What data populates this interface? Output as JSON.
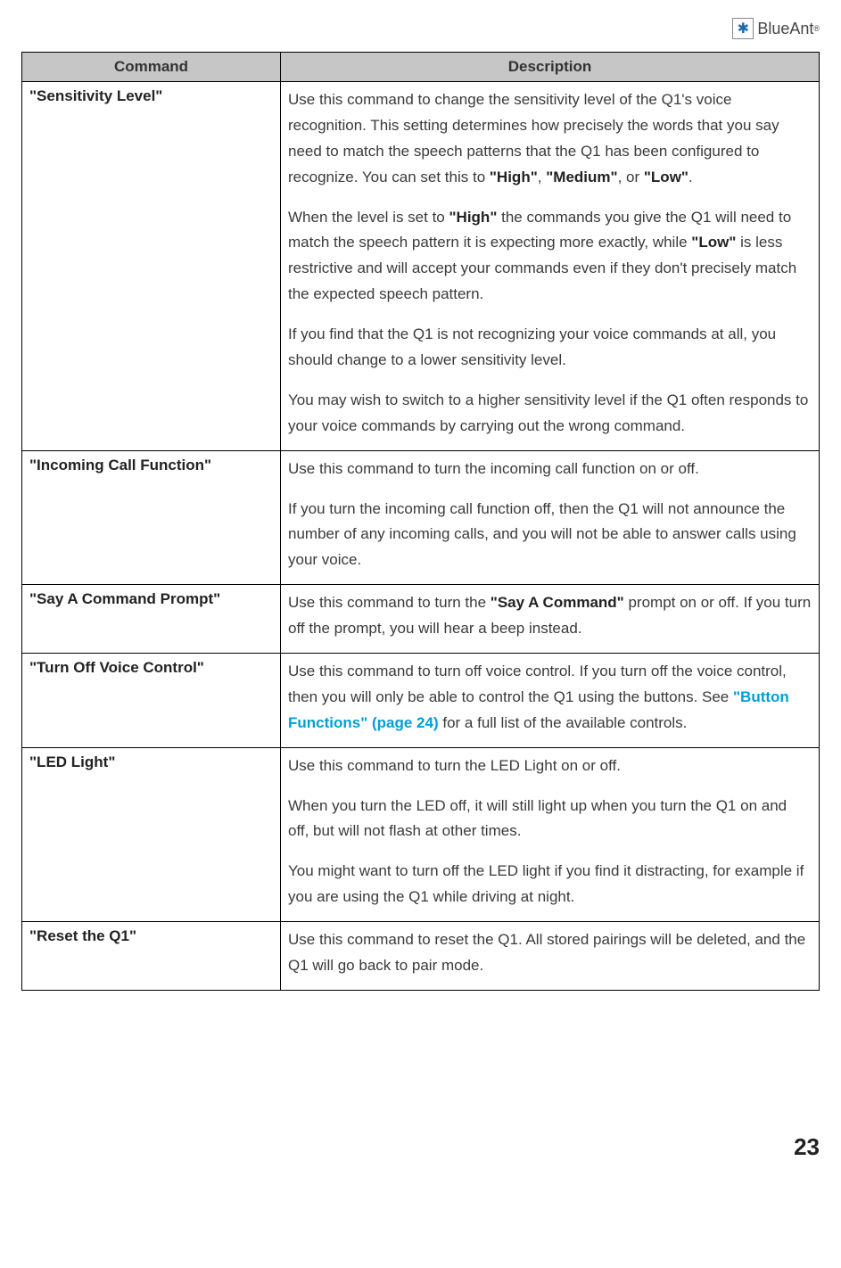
{
  "brand": "BlueAnt",
  "table": {
    "headers": {
      "command": "Command",
      "description": "Description"
    },
    "rows": [
      {
        "command": "\"Sensitivity Level\"",
        "desc": {
          "p1_a": "Use this command to change the sensitivity level of the Q1's voice recognition. This setting determines how precisely the words that you say need to match the speech patterns that the Q1 has been configured to recognize. You can set this to ",
          "p1_b1": "\"High\"",
          "p1_c": ", ",
          "p1_b2": "\"Medium\"",
          "p1_d": ", or ",
          "p1_b3": "\"Low\"",
          "p1_e": ".",
          "p2_a": "When the level is set to ",
          "p2_b1": "\"High\"",
          "p2_c": " the commands you give the Q1 will need to match the speech pattern it is expecting more exactly, while ",
          "p2_b2": "\"Low\"",
          "p2_d": " is less restrictive and will accept your commands even if they don't precisely match the expected speech pattern.",
          "p3": "If you find that the Q1 is not recognizing your voice commands at all, you should change to a lower sensitivity level.",
          "p4": "You may wish to switch to a higher sensitivity level if the Q1 often responds to your voice commands by carrying out the wrong command."
        }
      },
      {
        "command": "\"Incoming Call Function\"",
        "desc": {
          "p1": "Use this command to turn the incoming call function on or off.",
          "p2": "If you turn the incoming call function off, then the Q1 will not announce the number of any incoming calls, and you will not be able to answer calls using your voice."
        }
      },
      {
        "command": "\"Say A Command Prompt\"",
        "desc": {
          "p1_a": "Use this command to turn the ",
          "p1_b": "\"Say A Command\"",
          "p1_c": " prompt on or off. If you turn off the prompt, you will hear a beep instead."
        }
      },
      {
        "command": "\"Turn Off Voice Control\"",
        "desc": {
          "p1_a": "Use this command to turn off voice control. If you turn off the voice control, then you will only be able to control the Q1 using the buttons. See ",
          "p1_link": "\"Button Functions\" (page 24)",
          "p1_b": " for a full list of the available controls."
        }
      },
      {
        "command": "\"LED Light\"",
        "desc": {
          "p1": "Use this command to turn the LED Light on or off.",
          "p2": "When you turn the LED off, it will still light up when you turn the Q1 on and off, but will not flash at other times.",
          "p3": "You might want to turn off the LED light if you find it distracting, for example if you are using the Q1 while driving at night."
        }
      },
      {
        "command": "\"Reset the Q1\"",
        "desc": {
          "p1": "Use this command to reset the Q1. All stored pairings will be deleted, and the Q1 will go back to pair mode."
        }
      }
    ]
  },
  "page_number": "23"
}
